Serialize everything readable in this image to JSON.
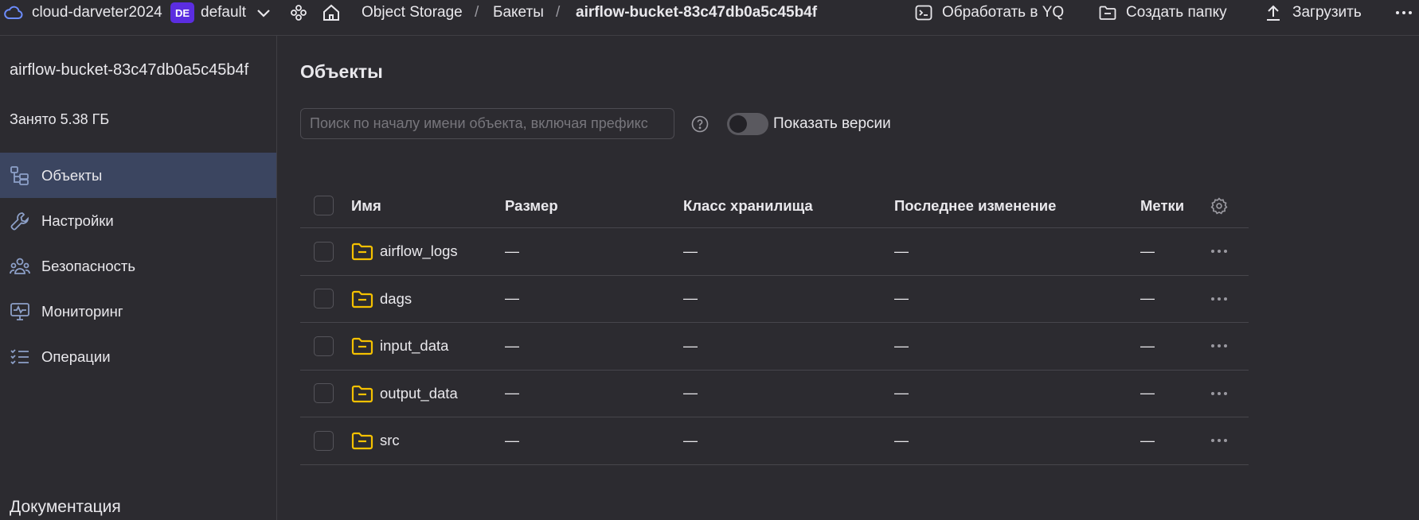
{
  "topbar": {
    "cloud_name": "cloud-darveter2024",
    "folder_badge": "DE",
    "folder_name": "default",
    "breadcrumbs": [
      "Object Storage",
      "Бакеты",
      "airflow-bucket-83c47db0a5c45b4f"
    ],
    "separator": "/",
    "actions": {
      "process_yq": "Обработать в YQ",
      "create_folder": "Создать папку",
      "upload": "Загрузить"
    },
    "accent_color": "#5b2de0"
  },
  "sidebar": {
    "bucket_name": "airflow-bucket-83c47db0a5c45b4f",
    "used": "Занято 5.38 ГБ",
    "items": [
      {
        "label": "Объекты",
        "icon": "objects-icon"
      },
      {
        "label": "Настройки",
        "icon": "wrench-icon"
      },
      {
        "label": "Безопасность",
        "icon": "users-icon"
      },
      {
        "label": "Мониторинг",
        "icon": "monitor-icon"
      },
      {
        "label": "Операции",
        "icon": "list-check-icon"
      }
    ],
    "docs": "Документация"
  },
  "main": {
    "title": "Объекты",
    "search_placeholder": "Поиск по началу имени объекта, включая префикс",
    "show_versions_label": "Показать версии",
    "show_versions_on": false,
    "columns": {
      "name": "Имя",
      "size": "Размер",
      "storage_class": "Класс хранилища",
      "modified": "Последнее изменение",
      "tags": "Метки"
    },
    "rows": [
      {
        "name": "airflow_logs",
        "size": "—",
        "storage_class": "—",
        "modified": "—",
        "tags": "—"
      },
      {
        "name": "dags",
        "size": "—",
        "storage_class": "—",
        "modified": "—",
        "tags": "—"
      },
      {
        "name": "input_data",
        "size": "—",
        "storage_class": "—",
        "modified": "—",
        "tags": "—"
      },
      {
        "name": "output_data",
        "size": "—",
        "storage_class": "—",
        "modified": "—",
        "tags": "—"
      },
      {
        "name": "src",
        "size": "—",
        "storage_class": "—",
        "modified": "—",
        "tags": "—"
      }
    ],
    "folder_color": "#f5c100"
  }
}
